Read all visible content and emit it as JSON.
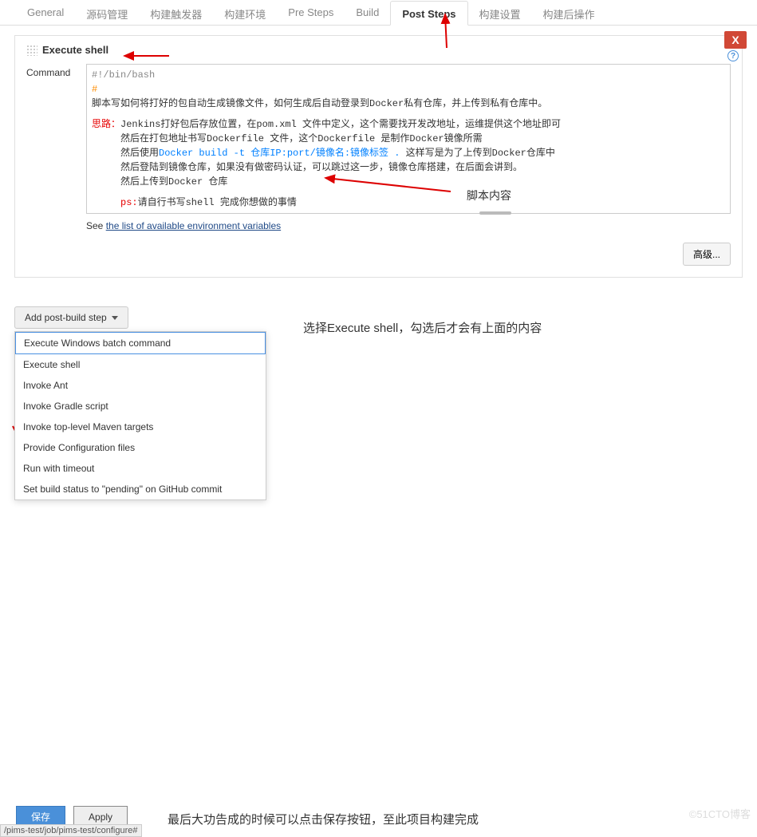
{
  "tabs": [
    {
      "label": "General"
    },
    {
      "label": "源码管理"
    },
    {
      "label": "构建触发器"
    },
    {
      "label": "构建环境"
    },
    {
      "label": "Pre Steps"
    },
    {
      "label": "Build"
    },
    {
      "label": "Post Steps"
    },
    {
      "label": "构建设置"
    },
    {
      "label": "构建后操作"
    }
  ],
  "active_tab": 6,
  "section": {
    "title": "Execute shell",
    "close": "X",
    "command_label": "Command",
    "see_text": "See ",
    "see_link": "the list of available environment variables",
    "advanced_button": "高级...",
    "script": {
      "l1": "#!/bin/bash",
      "l2": "#",
      "l3": "脚本写如何将打好的包自动生成镜像文件，如何生成后自动登录到Docker私有仓库，并上传到私有仓库中。",
      "l4a": "思路：",
      "l4b": "Jenkins打好包后存放位置，在pom.xml 文件中定义，这个需要找开发改地址，运维提供这个地址即可",
      "l5": "然后在打包地址书写Dockerfile 文件，这个Dockerfile 是制作Docker镜像所需",
      "l6a": "然后使用",
      "l6b": "Docker build -t 仓库IP:port/镜像名:镜像标签 .",
      "l6c": "   这样写是为了上传到Docker仓库中",
      "l7": "然后登陆到镜像仓库，如果没有做密码认证，可以跳过这一步，镜像仓库搭建，在后面会讲到。",
      "l8": "然后上传到Docker 仓库",
      "l9a": "ps:",
      "l9b": "请自行书写shell 完成你想做的事情"
    }
  },
  "dropdown": {
    "button": "Add post-build step",
    "items": [
      "Execute Windows batch command",
      "Execute shell",
      "Invoke Ant",
      "Invoke Gradle script",
      "Invoke top-level Maven targets",
      "Provide Configuration files",
      "Run with timeout",
      "Set build status to \"pending\" on GitHub commit"
    ]
  },
  "annotations": {
    "script_content": "脚本内容",
    "select_note": "选择Execute shell，勾选后才会有上面的内容",
    "final_note": "最后大功告成的时候可以点击保存按钮，至此项目构建完成"
  },
  "buttons": {
    "save": "保存",
    "apply": "Apply"
  },
  "watermark": "©51CTO博客",
  "status_path": "/pims-test/job/pims-test/configure#"
}
